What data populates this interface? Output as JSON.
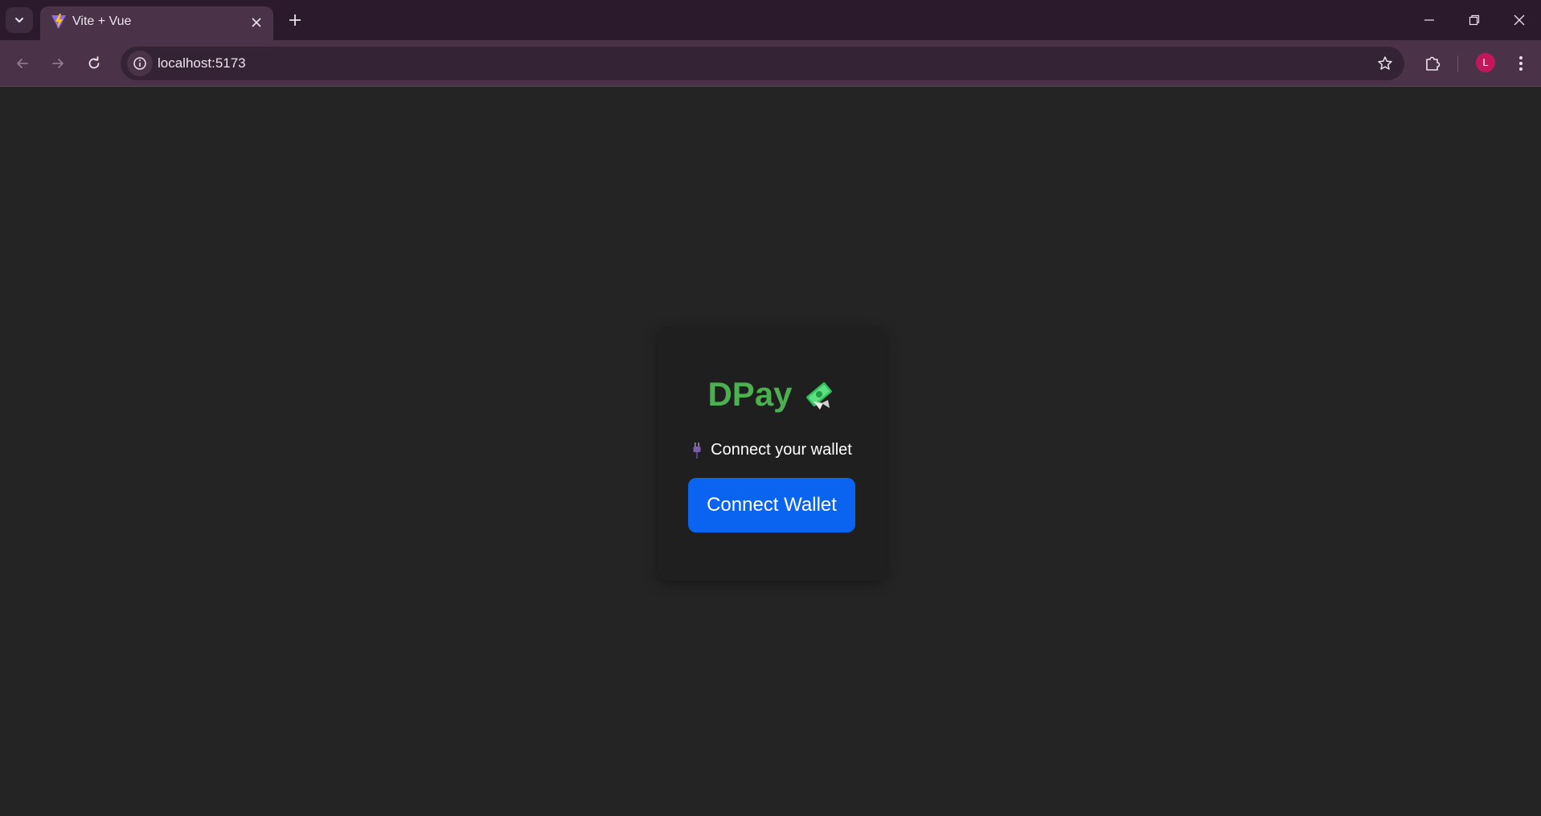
{
  "browser": {
    "tab": {
      "title": "Vite + Vue",
      "favicon": "vite-favicon"
    },
    "address_bar": {
      "url": "localhost:5173"
    },
    "profile": {
      "initial": "L",
      "color": "#c2185b"
    }
  },
  "app": {
    "brand": {
      "name": "DPay",
      "icon": "money-with-wings-icon",
      "color": "#4caf50"
    },
    "status": {
      "icon": "plug-icon",
      "text": "Connect your wallet"
    },
    "connect_button": {
      "label": "Connect Wallet",
      "color": "#0b64f0"
    }
  },
  "theme": {
    "page_background": "#242424",
    "card_background": "#1f1f1f",
    "chrome_background": "#2b1a2c"
  }
}
